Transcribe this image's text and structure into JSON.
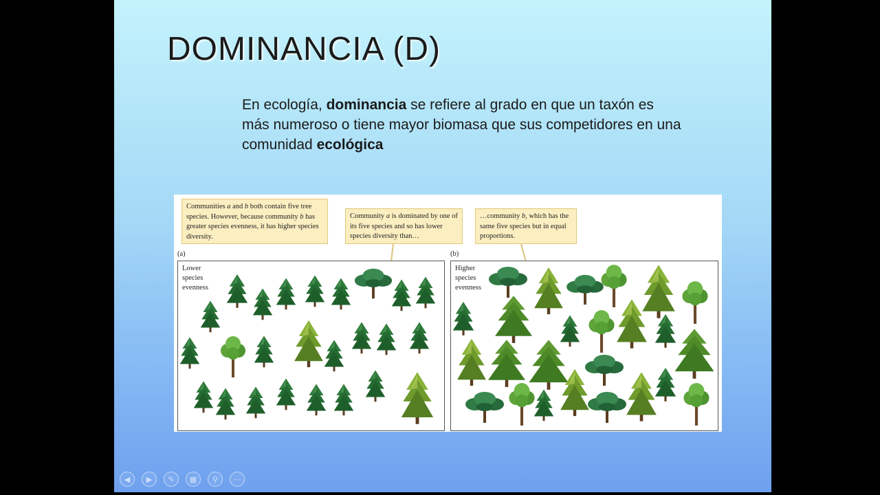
{
  "slide": {
    "title": "DOMINANCIA (D)",
    "body": {
      "p1": "En ecología, ",
      "b1": "dominancia",
      "p2": " se refiere al grado en que un taxón es más numeroso o tiene mayor biomasa que sus competidores en una comunidad ",
      "b2": "ecológica"
    }
  },
  "figure": {
    "callout1": {
      "t1": "Communities ",
      "a": "a",
      "t2": " and ",
      "b": "b",
      "t3": " both contain five tree species.  However, because community ",
      "b2": "b",
      "t4": " has greater species evenness, it has higher species diversity."
    },
    "callout2": {
      "t1": "Community ",
      "a": "a",
      "t2": " is dominated by one of its five species and so has lower species diversity than…"
    },
    "callout3": {
      "t1": "…community ",
      "b": "b,",
      "t2": " which has the same five species but in equal proportions."
    },
    "panel_a": {
      "label": "(a)",
      "caption": "Lower species evenness"
    },
    "panel_b": {
      "label": "(b)",
      "caption": "Higher species evenness"
    }
  },
  "controls": {
    "prev_icon": "previous-icon",
    "next_icon": "next-icon",
    "pen_icon": "pen-icon",
    "slides_icon": "slides-icon",
    "zoom_icon": "zoom-icon",
    "more_icon": "more-options-icon"
  }
}
